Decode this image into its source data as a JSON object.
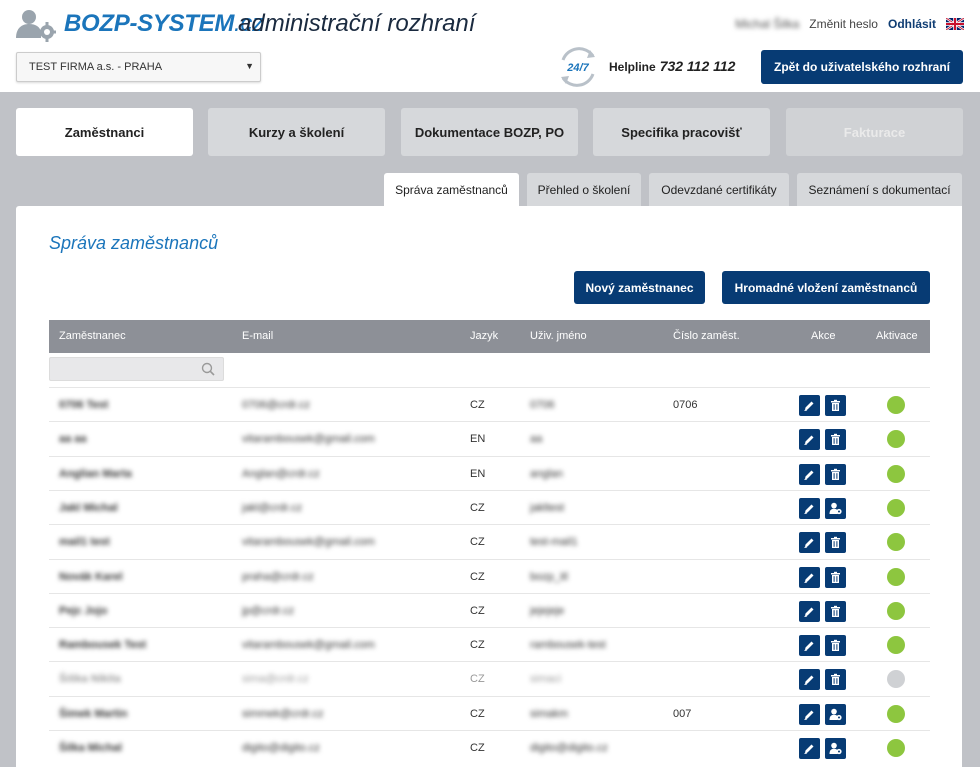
{
  "header": {
    "brand_main": "BOZP-SYSTEM",
    "brand_tld": ".cz",
    "brand_sub": "administrační rozhraní",
    "user_name": "Michal Šilka",
    "change_password": "Změnit heslo",
    "logout": "Odhlásit",
    "company_select": "TEST FIRMA a.s. - PRAHA",
    "badge_247": "24/7",
    "helpline_label": "Helpline",
    "helpline_number": "732 112 112",
    "back_button": "Zpět do uživatelského rozhraní"
  },
  "main_tabs": [
    "Zaměstnanci",
    "Kurzy a školení",
    "Dokumentace BOZP, PO",
    "Specifika pracovišť",
    "Fakturace"
  ],
  "sub_tabs": [
    "Správa zaměstnanců",
    "Přehled o školení",
    "Odevzdané certifikáty",
    "Seznámení s dokumentací"
  ],
  "page": {
    "title": "Správa zaměstnanců",
    "new_employee_button": "Nový zaměstnanec",
    "bulk_insert_button": "Hromadné vložení zaměstnanců"
  },
  "table": {
    "columns": [
      "Zaměstnanec",
      "E-mail",
      "Jazyk",
      "Uživ. jméno",
      "Číslo zaměst.",
      "Akce",
      "Aktivace"
    ],
    "rows": [
      {
        "name": "0706 Test",
        "email": "0706@crdr.cz",
        "lang": "CZ",
        "username": "0706",
        "number": "0706",
        "active": true,
        "second_action": "delete"
      },
      {
        "name": "aa aa",
        "email": "vitarambousek@gmail.com",
        "lang": "EN",
        "username": "aa",
        "number": "",
        "active": true,
        "second_action": "delete"
      },
      {
        "name": "Anglian Marta",
        "email": "Anglan@crdr.cz",
        "lang": "EN",
        "username": "anglan",
        "number": "",
        "active": true,
        "second_action": "delete"
      },
      {
        "name": "Jakl Michal",
        "email": "jakl@crdr.cz",
        "lang": "CZ",
        "username": "jakltest",
        "number": "",
        "active": true,
        "second_action": "user"
      },
      {
        "name": "mail1 test",
        "email": "vitarambousek@gmail.com",
        "lang": "CZ",
        "username": "test-mail1",
        "number": "",
        "active": true,
        "second_action": "delete"
      },
      {
        "name": "Novák Karel",
        "email": "praha@crdr.cz",
        "lang": "CZ",
        "username": "bozp_itl",
        "number": "",
        "active": true,
        "second_action": "delete"
      },
      {
        "name": "Pejc Jojo",
        "email": "jp@crdr.cz",
        "lang": "CZ",
        "username": "jejejeje",
        "number": "",
        "active": true,
        "second_action": "delete"
      },
      {
        "name": "Rambousek Test",
        "email": "vitarambousek@gmail.com",
        "lang": "CZ",
        "username": "rambousek-test",
        "number": "",
        "active": true,
        "second_action": "delete"
      },
      {
        "name": "Šiška Nikita",
        "email": "sima@crdr.cz",
        "lang": "CZ",
        "username": "simaci",
        "number": "",
        "active": false,
        "second_action": "delete"
      },
      {
        "name": "Šimek Martin",
        "email": "simmek@crdr.cz",
        "lang": "CZ",
        "username": "simakm",
        "number": "007",
        "active": true,
        "second_action": "user"
      },
      {
        "name": "Šilka Michal",
        "email": "digito@digito.cz",
        "lang": "CZ",
        "username": "digito@digito.cz",
        "number": "",
        "active": true,
        "second_action": "user"
      }
    ]
  },
  "colors": {
    "brand_blue": "#1b75bb",
    "navy": "#073b74",
    "active_green": "#8dc63f",
    "inactive_grey": "#cfd1d4",
    "header_grey": "#8d9097"
  }
}
